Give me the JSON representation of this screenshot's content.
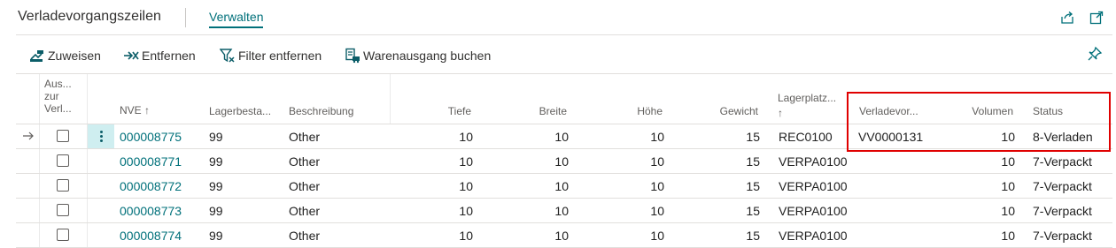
{
  "header": {
    "title": "Verladevorgangszeilen",
    "tab_manage": "Verwalten",
    "share_icon": "share-icon",
    "expand_icon": "expand-icon"
  },
  "actions": {
    "assign": "Zuweisen",
    "remove": "Entfernen",
    "clear_filter": "Filter entfernen",
    "post_shipment": "Warenausgang buchen",
    "pin_icon": "pin-icon"
  },
  "columns": {
    "exclude": [
      "Aus...",
      "zur",
      "Verl..."
    ],
    "nve": "NVE ↑",
    "stock": "Lagerbesta...",
    "description": "Beschreibung",
    "depth": "Tiefe",
    "width": "Breite",
    "height": "Höhe",
    "weight": "Gewicht",
    "bin_line1": "Lagerplatz...",
    "bin_line2": "↑",
    "loading_no": "Verladevor...",
    "volume": "Volumen",
    "status": "Status"
  },
  "rows": [
    {
      "nve": "000008775",
      "stock": "99",
      "description": "Other",
      "depth": "10",
      "width": "10",
      "height": "10",
      "weight": "15",
      "bin": "REC0100",
      "loading_no": "VV0000131",
      "volume": "10",
      "status": "8-Verladen"
    },
    {
      "nve": "000008771",
      "stock": "99",
      "description": "Other",
      "depth": "10",
      "width": "10",
      "height": "10",
      "weight": "15",
      "bin": "VERPA0100",
      "loading_no": "",
      "volume": "10",
      "status": "7-Verpackt"
    },
    {
      "nve": "000008772",
      "stock": "99",
      "description": "Other",
      "depth": "10",
      "width": "10",
      "height": "10",
      "weight": "15",
      "bin": "VERPA0100",
      "loading_no": "",
      "volume": "10",
      "status": "7-Verpackt"
    },
    {
      "nve": "000008773",
      "stock": "99",
      "description": "Other",
      "depth": "10",
      "width": "10",
      "height": "10",
      "weight": "15",
      "bin": "VERPA0100",
      "loading_no": "",
      "volume": "10",
      "status": "7-Verpackt"
    },
    {
      "nve": "000008774",
      "stock": "99",
      "description": "Other",
      "depth": "10",
      "width": "10",
      "height": "10",
      "weight": "15",
      "bin": "VERPA0100",
      "loading_no": "",
      "volume": "10",
      "status": "7-Verpackt"
    }
  ],
  "colors": {
    "accent": "#00707a",
    "highlight": "#e00000",
    "selected_menu": "#cfeef0"
  }
}
